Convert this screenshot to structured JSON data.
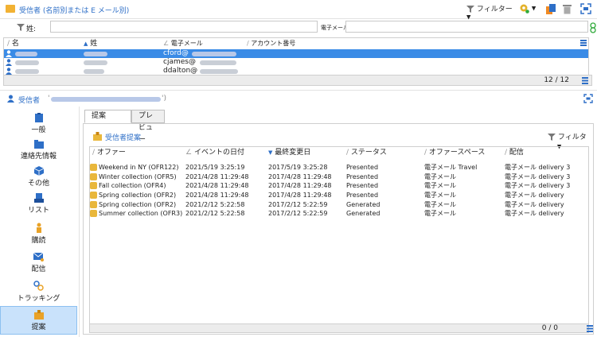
{
  "header": {
    "title": "受信者 (名前別または E メール別)",
    "filter_label": "フィルター"
  },
  "search": {
    "last_name_label": "姓:",
    "email_label": "電子メール"
  },
  "recipients_grid": {
    "columns": [
      "名",
      "姓",
      "電子メール",
      "アカウント番号"
    ],
    "rows": [
      {
        "email": "cford@"
      },
      {
        "email": "cjames@"
      },
      {
        "email": "ddalton@"
      }
    ],
    "count": "12 / 12"
  },
  "recipient_bar": {
    "label": "受信者"
  },
  "nav": {
    "items": [
      {
        "label": "一般",
        "icon": "clipboard-icon"
      },
      {
        "label": "連絡先情報",
        "icon": "folder-icon"
      },
      {
        "label": "その他",
        "icon": "cube-icon"
      },
      {
        "label": "リスト",
        "icon": "list-icon"
      },
      {
        "label": "購読",
        "icon": "user-icon"
      },
      {
        "label": "配信",
        "icon": "envelope-icon"
      },
      {
        "label": "トラッキング",
        "icon": "tracking-icon"
      },
      {
        "label": "提案",
        "icon": "proposal-icon"
      }
    ]
  },
  "tabs": {
    "proposals": "提案",
    "preview": "プレビュー"
  },
  "proposals": {
    "title": "受信者提案",
    "filter_label": "フィルター",
    "columns": [
      "オファー",
      "イベントの日付",
      "最終変更日",
      "ステータス",
      "オファースペース",
      "配信"
    ],
    "rows": [
      {
        "offer": "Weekend in NY (OFR122)",
        "event_date": "2021/5/19  3:25:19",
        "last_modified": "2017/5/19  3:25:28",
        "status": "Presented",
        "space": "電子メール Travel",
        "delivery": "電子メール  delivery 3"
      },
      {
        "offer": "Winter collection (OFR5)",
        "event_date": "2021/4/28  11:29:48",
        "last_modified": "2017/4/28  11:29:48",
        "status": "Presented",
        "space": "電子メール",
        "delivery": "電子メール  delivery 3"
      },
      {
        "offer": "Fall collection (OFR4)",
        "event_date": "2021/4/28  11:29:48",
        "last_modified": "2017/4/28  11:29:48",
        "status": "Presented",
        "space": "電子メール",
        "delivery": "電子メール  delivery 3"
      },
      {
        "offer": "Spring collection (OFR2)",
        "event_date": "2021/4/28  11:29:48",
        "last_modified": "2017/4/28  11:29:48",
        "status": "Presented",
        "space": "電子メール",
        "delivery": "電子メール  delivery"
      },
      {
        "offer": "Spring collection (OFR2)",
        "event_date": "2021/2/12  5:22:58",
        "last_modified": "2017/2/12  5:22:59",
        "status": "Generated",
        "space": "電子メール",
        "delivery": "電子メール  delivery"
      },
      {
        "offer": "Summer collection (OFR3)",
        "event_date": "2021/2/12  5:22:58",
        "last_modified": "2017/2/12  5:22:59",
        "status": "Generated",
        "space": "電子メール",
        "delivery": "電子メール  delivery"
      }
    ],
    "count": "0 / 0"
  },
  "colors": {
    "accent": "#2e6fc7",
    "selection": "#3a8be6",
    "nav_active": "#c9e2fb"
  }
}
